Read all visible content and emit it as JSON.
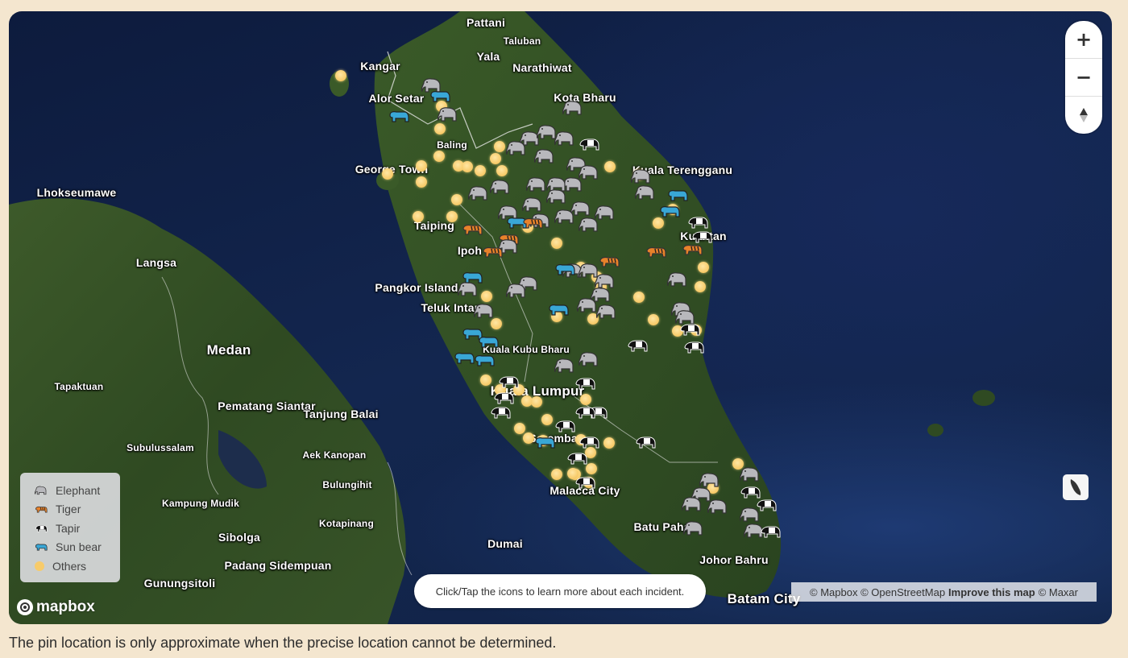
{
  "map": {
    "labels": [
      {
        "text": "Pattani",
        "size": "m"
      },
      {
        "text": "Taluban",
        "size": "s"
      },
      {
        "text": "Yala",
        "size": "m"
      },
      {
        "text": "Narathiwat",
        "size": "m"
      },
      {
        "text": "Kangar",
        "size": "m"
      },
      {
        "text": "Alor Setar",
        "size": "m"
      },
      {
        "text": "Kota Bharu",
        "size": "m"
      },
      {
        "text": "Baling",
        "size": "s"
      },
      {
        "text": "George Town",
        "size": "m"
      },
      {
        "text": "Kuala Terengganu",
        "size": "m"
      },
      {
        "text": "Lhokseumawe",
        "size": "m"
      },
      {
        "text": "Taiping",
        "size": "m"
      },
      {
        "text": "Kuantan",
        "size": "m"
      },
      {
        "text": "Langsa",
        "size": "m"
      },
      {
        "text": "Ipoh",
        "size": "m"
      },
      {
        "text": "Pangkor Island",
        "size": "m"
      },
      {
        "text": "Teluk Intan",
        "size": "m"
      },
      {
        "text": "Medan",
        "size": "l"
      },
      {
        "text": "Kuala Kubu Bharu",
        "size": "s"
      },
      {
        "text": "Tapaktuan",
        "size": "s"
      },
      {
        "text": "Kuala Lumpur",
        "size": "l"
      },
      {
        "text": "Pematang Siantar",
        "size": "m"
      },
      {
        "text": "Tanjung Balai",
        "size": "m"
      },
      {
        "text": "Seremban",
        "size": "m"
      },
      {
        "text": "Subulussalam",
        "size": "s"
      },
      {
        "text": "Aek Kanopan",
        "size": "s"
      },
      {
        "text": "Bulungihit",
        "size": "s"
      },
      {
        "text": "Kampung Mudik",
        "size": "s"
      },
      {
        "text": "Malacca City",
        "size": "m"
      },
      {
        "text": "Kotapinang",
        "size": "s"
      },
      {
        "text": "Batu Pahat",
        "size": "m"
      },
      {
        "text": "Sibolga",
        "size": "m"
      },
      {
        "text": "Dumai",
        "size": "m"
      },
      {
        "text": "Johor Bahru",
        "size": "m"
      },
      {
        "text": "Padang Sidempuan",
        "size": "m"
      },
      {
        "text": "Gunungsitoli",
        "size": "m"
      },
      {
        "text": "Batam City",
        "size": "l"
      }
    ],
    "controls": {
      "zoom_in": "+",
      "zoom_out": "−",
      "compass": "▲"
    },
    "legend": [
      {
        "label": "Elephant",
        "icon": "elephant-icon"
      },
      {
        "label": "Tiger",
        "icon": "tiger-icon"
      },
      {
        "label": "Tapir",
        "icon": "tapir-icon"
      },
      {
        "label": "Sun bear",
        "icon": "sun-bear-icon"
      },
      {
        "label": "Others",
        "icon": "others-dot-icon"
      }
    ],
    "hint": "Click/Tap the icons to learn more about each incident.",
    "attribution": {
      "mapbox": "© Mapbox",
      "osm": "© OpenStreetMap",
      "improve": "Improve this map",
      "maxar": "© Maxar"
    },
    "logo": "mapbox",
    "colors": {
      "elephant": "#b8b8bc",
      "tiger": "#e8822a",
      "tapir": "#111111",
      "sun_bear": "#39a7d6",
      "others": "#f7cb6a"
    }
  },
  "caption": "The pin location is only approximate when the precise location cannot be determined."
}
